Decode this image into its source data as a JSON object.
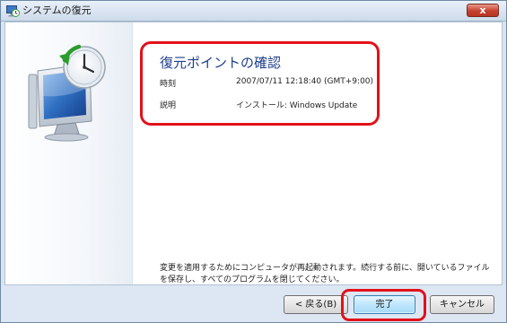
{
  "window": {
    "title": "システムの復元",
    "icon": "system-restore-icon",
    "close_label": "x"
  },
  "hero": {
    "icon": "system-restore-monitor-clock-icon"
  },
  "main": {
    "heading": "復元ポイントの確認",
    "time_label": "時刻",
    "time_value": "2007/07/11 12:18:40 (GMT+9:00)",
    "description_label": "説明",
    "description_value": "インストール: Windows Update",
    "note": "変更を適用するためにコンピュータが再起動されます。続行する前に、開いているファイルを保存し、すべてのプログラムを閉じてください。"
  },
  "buttons": {
    "back": "< 戻る(B)",
    "finish": "完了",
    "cancel": "キャンセル"
  },
  "colors": {
    "heading": "#1e3f8a",
    "highlight": "#e2111a",
    "titlebar": "#cddbea",
    "close": "#c6412e"
  }
}
